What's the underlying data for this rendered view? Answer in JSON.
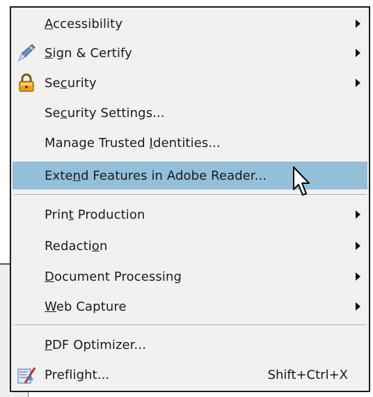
{
  "menu": {
    "items": [
      {
        "label": "Accessibility",
        "mnemonic_index": 0,
        "submenu": true,
        "icon": ""
      },
      {
        "label": "Sign & Certify",
        "mnemonic_index": 0,
        "submenu": true,
        "icon": "pen-icon"
      },
      {
        "label": "Security",
        "mnemonic_index": 2,
        "submenu": true,
        "icon": "lock-icon"
      },
      {
        "label": "Security Settings...",
        "mnemonic_index": 2,
        "submenu": false,
        "icon": ""
      },
      {
        "label": "Manage Trusted Identities...",
        "mnemonic_index": 15,
        "submenu": false,
        "icon": ""
      },
      {
        "label": "Extend Features in Adobe Reader...",
        "mnemonic_index": 4,
        "submenu": false,
        "icon": "",
        "highlighted": true
      },
      {
        "label": "Print Production",
        "mnemonic_index": 4,
        "submenu": true,
        "icon": ""
      },
      {
        "label": "Redaction",
        "mnemonic_index": 7,
        "submenu": true,
        "icon": ""
      },
      {
        "label": "Document Processing",
        "mnemonic_index": 0,
        "submenu": true,
        "icon": ""
      },
      {
        "label": "Web Capture",
        "mnemonic_index": 0,
        "submenu": true,
        "icon": ""
      },
      {
        "label": "PDF Optimizer...",
        "mnemonic_index": 0,
        "submenu": false,
        "icon": ""
      },
      {
        "label": "Preflight...",
        "mnemonic_index": 6,
        "submenu": false,
        "icon": "preflight-icon",
        "shortcut": "Shift+Ctrl+X"
      }
    ]
  },
  "colors": {
    "menu_background": "#f1f1f0",
    "highlight": "#93bfd9",
    "border": "#1a1a1a"
  }
}
